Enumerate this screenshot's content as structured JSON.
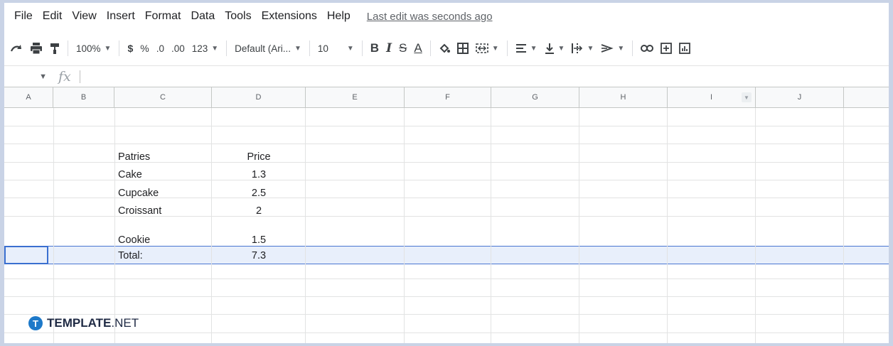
{
  "menu": {
    "items": [
      "File",
      "Edit",
      "View",
      "Insert",
      "Format",
      "Data",
      "Tools",
      "Extensions",
      "Help"
    ],
    "last_edit": "Last edit was seconds ago"
  },
  "toolbar": {
    "zoom": "100%",
    "currency": "$",
    "percent": "%",
    "decrease_decimal": ".0",
    "increase_decimal": ".00",
    "more_formats": "123",
    "font_family": "Default (Ari...",
    "font_size": "10",
    "bold": "B",
    "italic": "I",
    "strikethrough": "S",
    "text_color": "A"
  },
  "formula_bar": {
    "fx": "fx",
    "value": ""
  },
  "columns": [
    "A",
    "B",
    "C",
    "D",
    "E",
    "F",
    "G",
    "H",
    "I",
    "J"
  ],
  "table": {
    "header": {
      "item": "Patries",
      "price": "Price"
    },
    "rows": [
      {
        "item": "Cake",
        "price": "1.3"
      },
      {
        "item": "Cupcake",
        "price": "2.5"
      },
      {
        "item": "Croissant",
        "price": "2"
      },
      {
        "item": "Cookie",
        "price": "1.5"
      }
    ],
    "total": {
      "label": "Total:",
      "value": "7.3"
    }
  },
  "logo": {
    "badge": "T",
    "brand": "TEMPLATE",
    "suffix": ".NET"
  }
}
